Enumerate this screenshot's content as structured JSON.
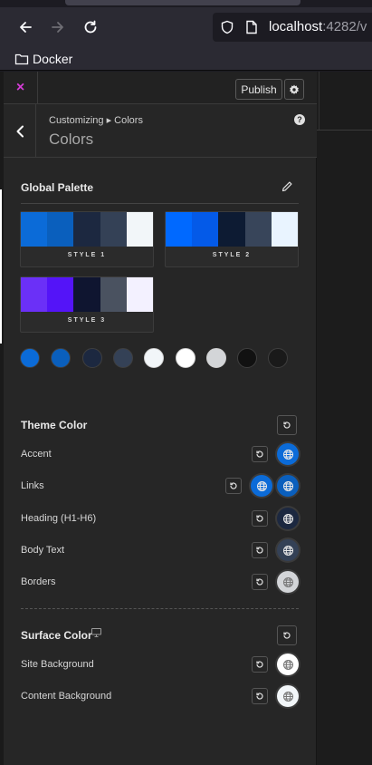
{
  "browser": {
    "url_host": "localhost",
    "url_rest": ":4282/v",
    "bookmark_folder": "Docker"
  },
  "header": {
    "close_glyph": "×",
    "publish_label": "Publish"
  },
  "section": {
    "breadcrumb": "Customizing ▸ Colors",
    "title": "Colors",
    "help_glyph": "?"
  },
  "global_palette": {
    "title": "Global Palette",
    "styles": [
      {
        "label": "STYLE 1",
        "colors": [
          "#0b6bd8",
          "#0a5fbd",
          "#1c2840",
          "#344156",
          "#f2f6f9"
        ]
      },
      {
        "label": "STYLE 2",
        "colors": [
          "#0069ff",
          "#045ae8",
          "#0d1b33",
          "#38455a",
          "#e9f4ff"
        ]
      },
      {
        "label": "STYLE 3",
        "colors": [
          "#6b30f7",
          "#5414f8",
          "#0f1530",
          "#4a5260",
          "#f3f1ff"
        ]
      }
    ],
    "dots": [
      "#0b6bd8",
      "#0a5fbd",
      "#1c2840",
      "#344156",
      "#f2f6f9",
      "#ffffff",
      "#d3d5d8",
      "#111111",
      "#1a1a1a"
    ]
  },
  "theme_color": {
    "title": "Theme Color",
    "rows": [
      {
        "label": "Accent",
        "colors": [
          "#0b6bd8"
        ]
      },
      {
        "label": "Links",
        "colors": [
          "#0b6bd8",
          "#0a5fbd"
        ]
      },
      {
        "label": "Heading (H1-H6)",
        "colors": [
          "#1c2840"
        ]
      },
      {
        "label": "Body Text",
        "colors": [
          "#344156"
        ]
      },
      {
        "label": "Borders",
        "colors": [
          "#d3d5d8"
        ]
      }
    ]
  },
  "surface_color": {
    "title": "Surface Color",
    "rows": [
      {
        "label": "Site Background",
        "colors": [
          "#ffffff"
        ]
      },
      {
        "label": "Content Background",
        "colors": [
          "#f2f6f9"
        ]
      }
    ]
  }
}
